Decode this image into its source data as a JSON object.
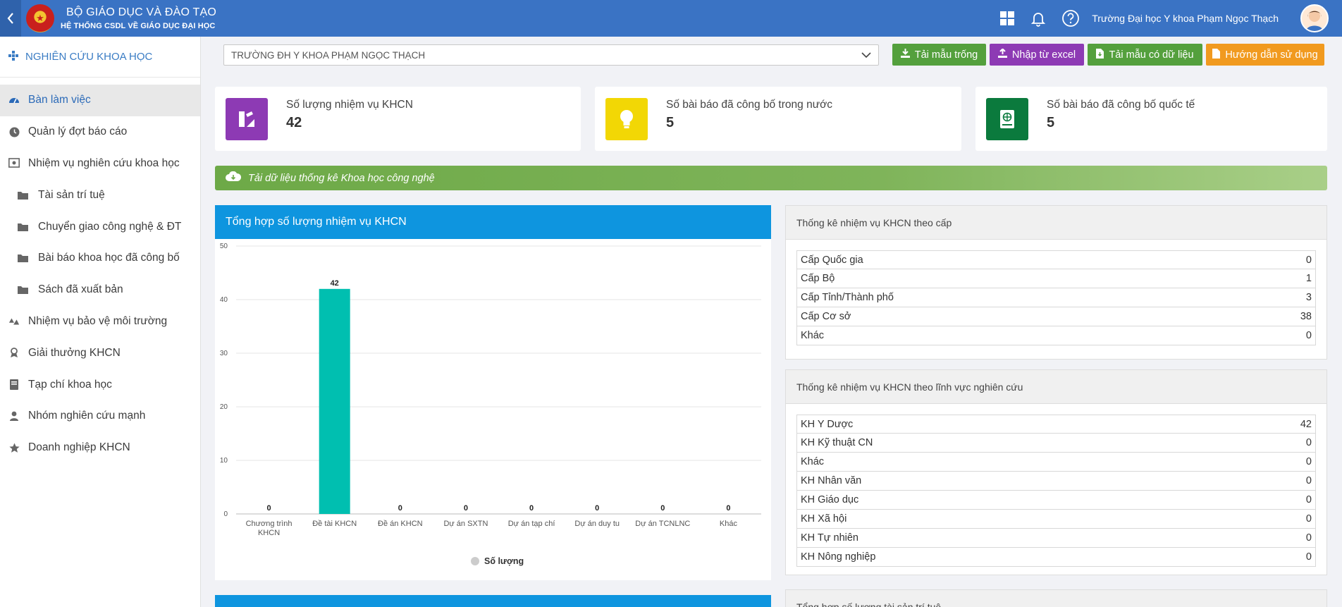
{
  "header": {
    "title": "BỘ GIÁO DỤC VÀ ĐÀO TẠO",
    "subtitle": "HỆ THỐNG CSDL VỀ GIÁO DỤC ĐẠI HỌC",
    "user_name": "Trường Đại học Y khoa Phạm Ngọc Thạch"
  },
  "sidebar": {
    "section_title": "NGHIÊN CỨU KHOA HỌC",
    "items": [
      {
        "label": "Bàn làm việc",
        "icon": "dashboard-icon",
        "active": true
      },
      {
        "label": "Quản lý đợt báo cáo",
        "icon": "clock-icon"
      },
      {
        "label": "Nhiệm vụ nghiên cứu khoa học",
        "icon": "safe-icon"
      },
      {
        "label": "Tài sản trí tuệ",
        "icon": "folder-icon",
        "sub": true
      },
      {
        "label": "Chuyển giao công nghệ & ĐT",
        "icon": "folder-icon",
        "sub": true
      },
      {
        "label": "Bài báo khoa học đã công bố",
        "icon": "folder-icon",
        "sub": true
      },
      {
        "label": "Sách đã xuất bản",
        "icon": "folder-icon",
        "sub": true
      },
      {
        "label": "Nhiệm vụ bảo vệ môi trường",
        "icon": "recycle-icon"
      },
      {
        "label": "Giải thưởng KHCN",
        "icon": "award-icon"
      },
      {
        "label": "Tạp chí khoa học",
        "icon": "book-icon"
      },
      {
        "label": "Nhóm nghiên cứu mạnh",
        "icon": "team-icon"
      },
      {
        "label": "Doanh nghiệp KHCN",
        "icon": "star-icon"
      }
    ]
  },
  "toolbar": {
    "school_select_value": "TRƯỜNG ĐH Y KHOA PHẠM NGỌC THẠCH",
    "btn_blank_template": "Tải mẫu trống",
    "btn_import_excel": "Nhập từ excel",
    "btn_template_with_data": "Tải mẫu có dữ liệu",
    "btn_guide": "Hướng dẫn sử dụng"
  },
  "stats": [
    {
      "label": "Số lượng nhiệm vụ KHCN",
      "value": "42",
      "color": "#8d3ab4"
    },
    {
      "label": "Số bài báo đã công bố trong nước",
      "value": "5",
      "color": "#f2d705"
    },
    {
      "label": "Số bài báo đã công bố quốc tế",
      "value": "5",
      "color": "#0b7a3d"
    }
  ],
  "download_bar": "Tải dữ liệu thống kê Khoa học công nghệ",
  "chart_panel": {
    "title": "Tổng hợp số lượng nhiệm vụ KHCN"
  },
  "chart_data": {
    "type": "bar",
    "categories": [
      "Chương trình KHCN",
      "Đề tài KHCN",
      "Đề án KHCN",
      "Dự án SXTN",
      "Dự án tạp chí",
      "Dự án duy tu",
      "Dự án TCNLNC",
      "Khác"
    ],
    "category_lines": [
      [
        "Chương trình",
        "KHCN"
      ],
      [
        "Đề tài KHCN"
      ],
      [
        "Đề án KHCN"
      ],
      [
        "Dự án SXTN"
      ],
      [
        "Dự án tạp chí"
      ],
      [
        "Dự án duy tu"
      ],
      [
        "Dự án TCNLNC"
      ],
      [
        "Khác"
      ]
    ],
    "series": [
      {
        "name": "Số lượng",
        "values": [
          0,
          42,
          0,
          0,
          0,
          0,
          0,
          0
        ]
      }
    ],
    "ylim": [
      0,
      50
    ],
    "yticks": [
      0,
      10,
      20,
      30,
      40,
      50
    ],
    "bar_color": "#00bfb0",
    "grid": true,
    "legend": "bottom"
  },
  "table_by_level": {
    "title": "Thống kê nhiệm vụ KHCN theo cấp",
    "rows": [
      {
        "label": "Cấp Quốc gia",
        "value": "0"
      },
      {
        "label": "Cấp Bộ",
        "value": "1"
      },
      {
        "label": "Cấp Tỉnh/Thành phố",
        "value": "3"
      },
      {
        "label": "Cấp Cơ sở",
        "value": "38"
      },
      {
        "label": "Khác",
        "value": "0"
      }
    ]
  },
  "table_by_field": {
    "title": "Thống kê nhiệm vụ KHCN theo lĩnh vực nghiên cứu",
    "rows": [
      {
        "label": "KH Y Dược",
        "value": "42"
      },
      {
        "label": "KH Kỹ thuật CN",
        "value": "0"
      },
      {
        "label": "Khác",
        "value": "0"
      },
      {
        "label": "KH Nhân văn",
        "value": "0"
      },
      {
        "label": "KH Giáo dục",
        "value": "0"
      },
      {
        "label": "KH Xã hội",
        "value": "0"
      },
      {
        "label": "KH Tự nhiên",
        "value": "0"
      },
      {
        "label": "KH Nông nghiệp",
        "value": "0"
      }
    ]
  },
  "table_ip": {
    "title": "Tổng hợp số lượng tài sản trí tuệ"
  }
}
